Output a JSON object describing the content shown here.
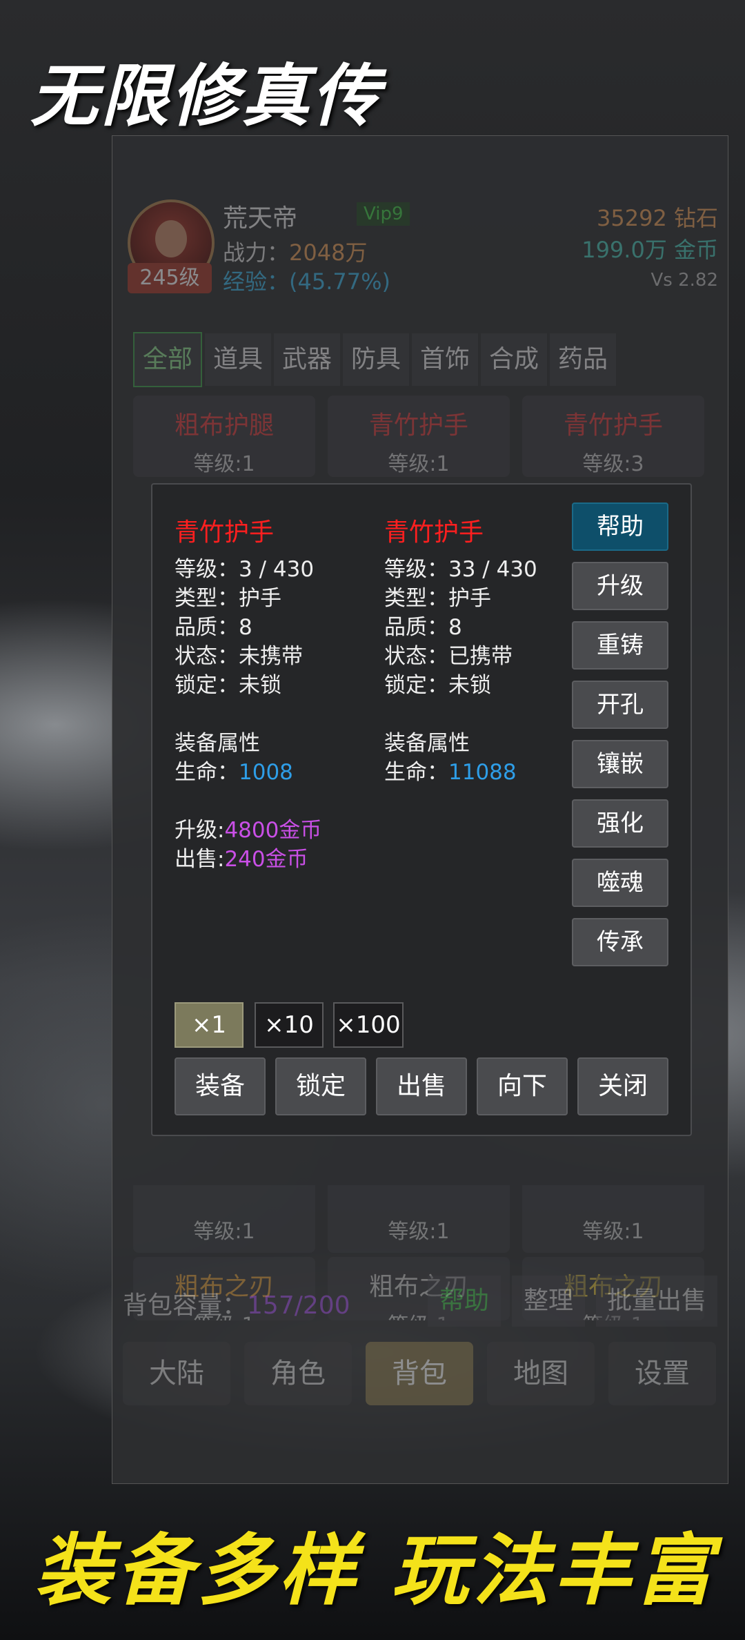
{
  "banner": {
    "top_title": "无限修真传",
    "bottom_title": "装备多样 玩法丰富"
  },
  "player": {
    "name": "荒天帝",
    "vip": "Vip9",
    "level_badge": "245级",
    "power_label": "战力：",
    "power_value": "2048万",
    "exp_text": "经验：(45.77%)",
    "diamond": "35292 钻石",
    "gold": "199.0万 金币",
    "version": "Vs 2.82"
  },
  "tabs": [
    "全部",
    "道具",
    "武器",
    "防具",
    "首饰",
    "合成",
    "药品"
  ],
  "inventory": {
    "top_row": [
      {
        "name": "粗布护腿",
        "level": "等级:1",
        "color": "#e04040"
      },
      {
        "name": "青竹护手",
        "level": "等级:1",
        "color": "#e04040"
      },
      {
        "name": "青竹护手",
        "level": "等级:3",
        "color": "#e04040"
      }
    ],
    "bottom_row1": [
      {
        "level": "等级:1"
      },
      {
        "level": "等级:1"
      },
      {
        "level": "等级:1"
      }
    ],
    "bottom_row2": [
      {
        "name": "粗布之刃",
        "level": "等级:1",
        "color": "#e0a040"
      },
      {
        "name": "粗布之刃",
        "level": "等级:1",
        "color": "#cccccc"
      },
      {
        "name": "粗布之刃",
        "level": "等级:1",
        "color": "#e0c040"
      }
    ]
  },
  "bag": {
    "label": "背包容量：",
    "count": "157/200",
    "help": "帮助",
    "sort": "整理",
    "bulk_sell": "批量出售"
  },
  "nav": [
    "大陆",
    "角色",
    "背包",
    "地图",
    "设置"
  ],
  "dialog": {
    "item_left": {
      "name": "青竹护手",
      "level": "等级：3 / 430",
      "type": "类型：护手",
      "quality": "品质：8",
      "status": "状态：未携带",
      "lock": "锁定：未锁",
      "attr_title": "装备属性",
      "hp_label": "生命：",
      "hp_value": "1008",
      "upgrade_label": "升级:",
      "upgrade_cost": "4800金币",
      "sell_label": "出售:",
      "sell_price": "240金币"
    },
    "item_right": {
      "name": "青竹护手",
      "level": "等级：33 / 430",
      "type": "类型：护手",
      "quality": "品质：8",
      "status": "状态：已携带",
      "lock": "锁定：未锁",
      "attr_title": "装备属性",
      "hp_label": "生命：",
      "hp_value": "11088"
    },
    "side_buttons": [
      "帮助",
      "升级",
      "重铸",
      "开孔",
      "镶嵌",
      "强化",
      "噬魂",
      "传承"
    ],
    "multipliers": [
      "×1",
      "×10",
      "×100"
    ],
    "actions": [
      "装备",
      "锁定",
      "出售",
      "向下",
      "关闭"
    ]
  }
}
